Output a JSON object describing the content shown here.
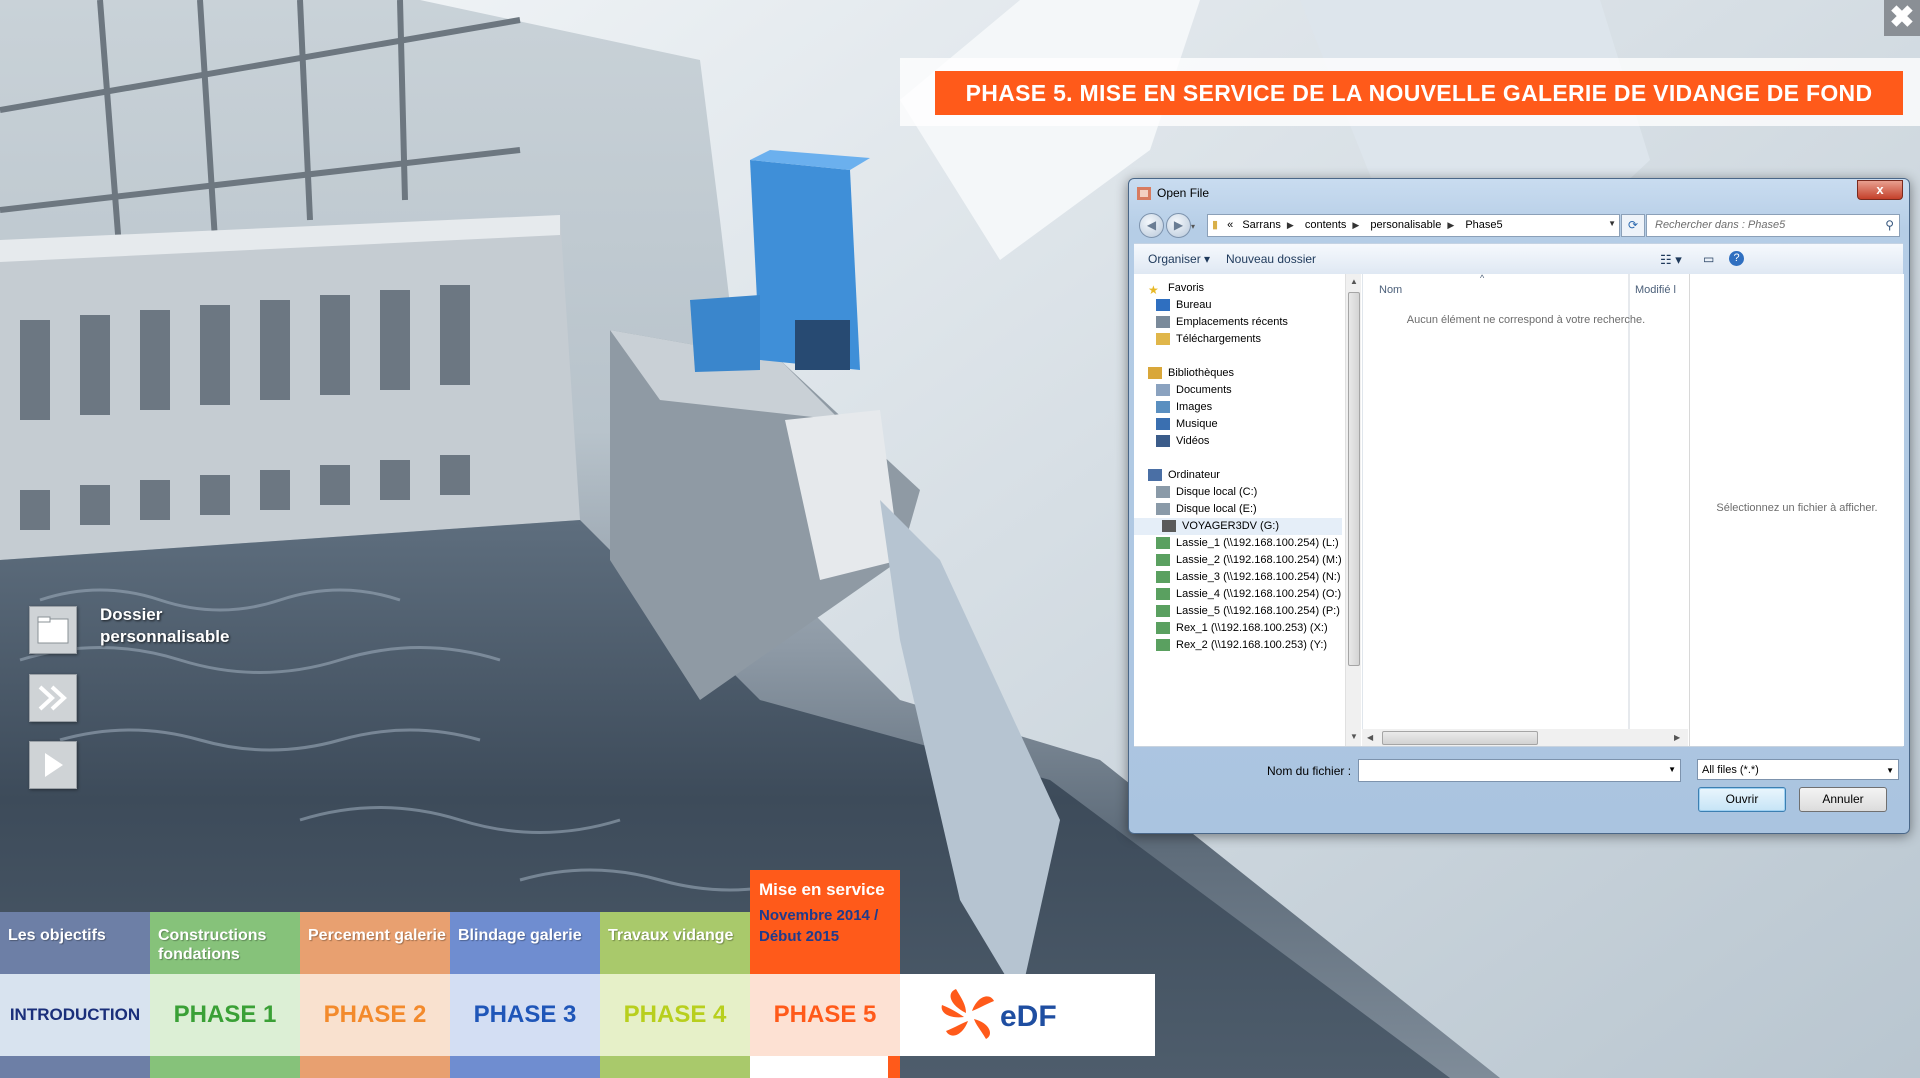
{
  "app": {
    "close_glyph": "✖",
    "banner_title": "PHASE 5. MISE EN SERVICE DE LA NOUVELLE GALERIE DE VIDANGE DE FOND"
  },
  "side": {
    "folder_label_line1": "Dossier",
    "folder_label_line2": "personnalisable",
    "icons": [
      "folder-icon",
      "fast-forward-icon",
      "play-icon"
    ]
  },
  "nav": {
    "items": [
      {
        "top": "Les objectifs",
        "bottom": "INTRODUCTION",
        "top_color": "#6d7fa6",
        "bottom_bg": "#d8e3ef",
        "bottom_color": "#1a2f7a"
      },
      {
        "top": "Constructions fondations",
        "bottom": "PHASE 1",
        "top_color": "#86c27a",
        "bottom_bg": "#dcefd5",
        "bottom_color": "#3aa036"
      },
      {
        "top": "Percement galerie",
        "bottom": "PHASE 2",
        "top_color": "#e8a070",
        "bottom_bg": "#f9e1cf",
        "bottom_color": "#f38a2c"
      },
      {
        "top": "Blindage galerie",
        "bottom": "PHASE 3",
        "top_color": "#6f8dd0",
        "bottom_bg": "#d3def3",
        "bottom_color": "#1f56b8"
      },
      {
        "top": "Travaux vidange",
        "bottom": "PHASE 4",
        "top_color": "#a9c96b",
        "bottom_bg": "#e6f0c8",
        "bottom_color": "#b8cf1e"
      }
    ],
    "active": {
      "top": "Mise en service",
      "date": "Novembre 2014 / Début 2015",
      "bottom": "PHASE 5",
      "bottom_bg": "#fde1d3",
      "bottom_color": "#ff5a1a"
    },
    "logo_text": "eDF"
  },
  "dialog": {
    "title": "Open File",
    "close_glyph": "x",
    "breadcrumb": [
      "«",
      "Sarrans",
      "contents",
      "personalisable",
      "Phase5"
    ],
    "search_placeholder": "Rechercher dans : Phase5",
    "toolbar": {
      "organize": "Organiser ▾",
      "new_folder": "Nouveau dossier"
    },
    "tree": [
      {
        "label": "Favoris",
        "level": 0,
        "icon": "star-icon"
      },
      {
        "label": "Bureau",
        "level": 1,
        "icon": "desktop-icon"
      },
      {
        "label": "Emplacements récents",
        "level": 1,
        "icon": "recent-places-icon"
      },
      {
        "label": "Téléchargements",
        "level": 1,
        "icon": "downloads-icon"
      },
      {
        "label": "Bibliothèques",
        "level": 0,
        "icon": "libraries-icon"
      },
      {
        "label": "Documents",
        "level": 1,
        "icon": "documents-icon"
      },
      {
        "label": "Images",
        "level": 1,
        "icon": "images-icon"
      },
      {
        "label": "Musique",
        "level": 1,
        "icon": "music-icon"
      },
      {
        "label": "Vidéos",
        "level": 1,
        "icon": "videos-icon"
      },
      {
        "label": "Ordinateur",
        "level": 0,
        "icon": "computer-icon"
      },
      {
        "label": "Disque local (C:)",
        "level": 1,
        "icon": "drive-icon"
      },
      {
        "label": "Disque local (E:)",
        "level": 1,
        "icon": "drive-icon"
      },
      {
        "label": "VOYAGER3DV (G:)",
        "level": 1,
        "icon": "removable-drive-icon",
        "selected": true
      },
      {
        "label": "Lassie_1 (\\\\192.168.100.254) (L:)",
        "level": 1,
        "icon": "network-drive-icon"
      },
      {
        "label": "Lassie_2 (\\\\192.168.100.254) (M:)",
        "level": 1,
        "icon": "network-drive-icon"
      },
      {
        "label": "Lassie_3 (\\\\192.168.100.254) (N:)",
        "level": 1,
        "icon": "network-drive-icon"
      },
      {
        "label": "Lassie_4 (\\\\192.168.100.254) (O:)",
        "level": 1,
        "icon": "network-drive-icon"
      },
      {
        "label": "Lassie_5 (\\\\192.168.100.254) (P:)",
        "level": 1,
        "icon": "network-drive-icon"
      },
      {
        "label": "Rex_1 (\\\\192.168.100.253) (X:)",
        "level": 1,
        "icon": "network-drive-icon"
      },
      {
        "label": "Rex_2 (\\\\192.168.100.253) (Y:)",
        "level": 1,
        "icon": "network-drive-icon"
      }
    ],
    "columns": {
      "name": "Nom",
      "modified": "Modifié l"
    },
    "empty_message": "Aucun élément ne correspond à votre recherche.",
    "preview_message": "Sélectionnez un fichier à afficher.",
    "filename_label": "Nom du fichier :",
    "filename_value": "",
    "filter": "All files (*.*)",
    "open_label": "Ouvrir",
    "cancel_label": "Annuler"
  }
}
